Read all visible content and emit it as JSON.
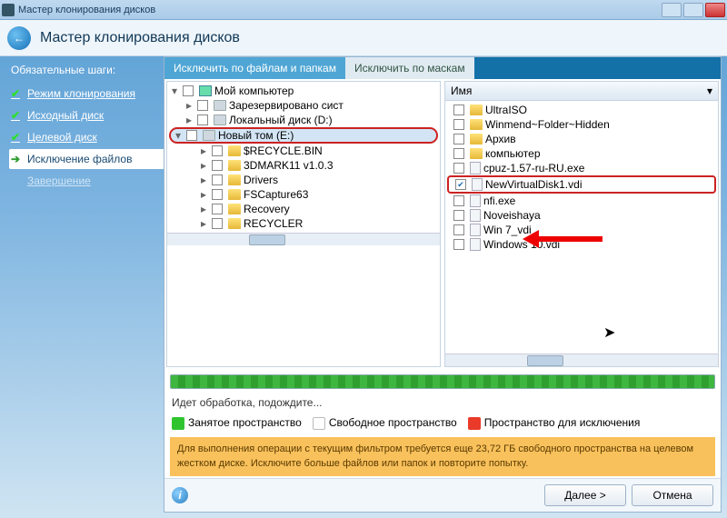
{
  "titlebar": {
    "text": "Мастер клонирования дисков"
  },
  "header": {
    "title": "Мастер клонирования дисков"
  },
  "sidebar": {
    "title": "Обязательные шаги:",
    "steps": [
      {
        "label": "Режим клонирования",
        "state": "done"
      },
      {
        "label": "Исходный диск",
        "state": "done"
      },
      {
        "label": "Целевой диск",
        "state": "done"
      },
      {
        "label": "Исключение файлов",
        "state": "active"
      },
      {
        "label": "Завершение",
        "state": "pending"
      }
    ]
  },
  "tabs": {
    "files": "Исключить по файлам и папкам",
    "masks": "Исключить по маскам"
  },
  "list_header": {
    "name": "Имя"
  },
  "tree": [
    {
      "label": "Мой компьютер",
      "indent": 0,
      "expander": "▾",
      "icon": "comp",
      "checked": false
    },
    {
      "label": "Зарезервировано сист",
      "indent": 1,
      "expander": "▸",
      "icon": "disk",
      "checked": false
    },
    {
      "label": "Локальный диск (D:)",
      "indent": 1,
      "expander": "▸",
      "icon": "disk",
      "checked": false
    },
    {
      "label": "Новый том (E:)",
      "indent": 1,
      "expander": "▾",
      "icon": "disk",
      "checked": false,
      "highlight": true
    },
    {
      "label": "$RECYCLE.BIN",
      "indent": 2,
      "expander": "▸",
      "icon": "folder",
      "checked": false
    },
    {
      "label": "3DMARK11 v1.0.3",
      "indent": 2,
      "expander": "▸",
      "icon": "folder",
      "checked": false
    },
    {
      "label": "Drivers",
      "indent": 2,
      "expander": "▸",
      "icon": "folder",
      "checked": false
    },
    {
      "label": "FSCapture63",
      "indent": 2,
      "expander": "▸",
      "icon": "folder",
      "checked": false
    },
    {
      "label": "Recovery",
      "indent": 2,
      "expander": "▸",
      "icon": "folder",
      "checked": false
    },
    {
      "label": "RECYCLER",
      "indent": 2,
      "expander": "▸",
      "icon": "folder",
      "checked": false
    }
  ],
  "files": [
    {
      "label": "UltraISO",
      "icon": "folder",
      "checked": false
    },
    {
      "label": "Winmend~Folder~Hidden",
      "icon": "folder",
      "checked": false
    },
    {
      "label": "Архив",
      "icon": "folder",
      "checked": false
    },
    {
      "label": "компьютер",
      "icon": "folder",
      "checked": false
    },
    {
      "label": "cpuz-1.57-ru-RU.exe",
      "icon": "file",
      "checked": false
    },
    {
      "label": "NewVirtualDisk1.vdi",
      "icon": "file",
      "checked": true,
      "highlight": true
    },
    {
      "label": "nfi.exe",
      "icon": "file",
      "checked": false
    },
    {
      "label": "Noveishaya",
      "icon": "file",
      "checked": false
    },
    {
      "label": "Win 7_vdi",
      "icon": "file",
      "checked": false
    },
    {
      "label": "Windows 10.vdi",
      "icon": "file",
      "checked": false
    }
  ],
  "status": "Идет обработка, подождите...",
  "legend": {
    "used": "Занятое пространство",
    "free": "Свободное пространство",
    "excl": "Пространство для исключения"
  },
  "warning": "Для выполнения операции с текущим фильтром требуется еще 23,72 ГБ свободного пространства на целевом жестком диске. Исключите больше файлов или папок и повторите попытку.",
  "buttons": {
    "next": "Далее >",
    "cancel": "Отмена"
  }
}
